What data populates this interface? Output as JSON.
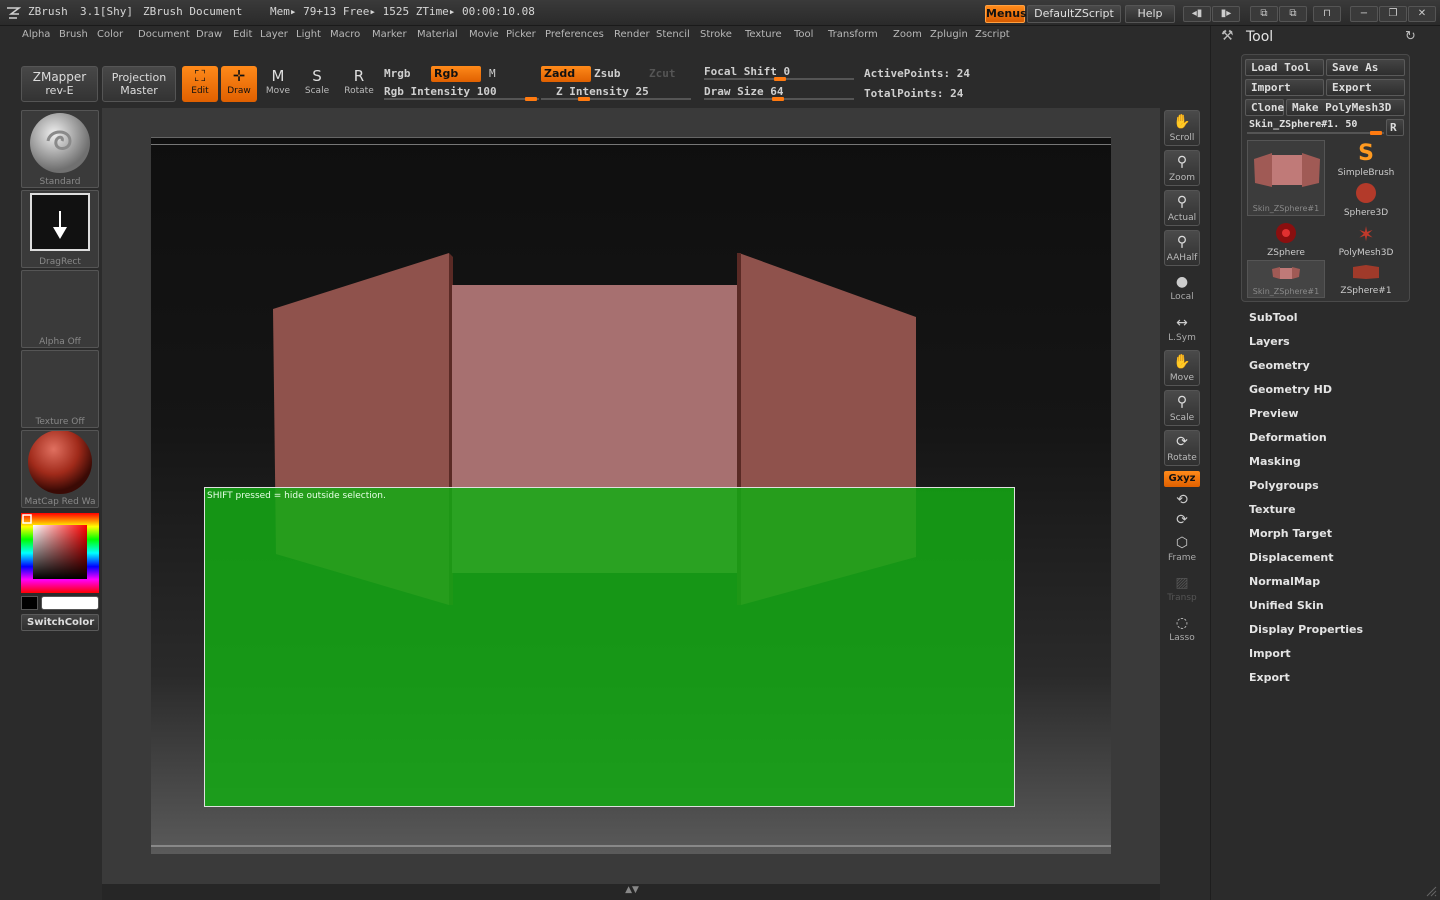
{
  "titlebar": {
    "app": "ZBrush",
    "version": "3.1[Shy]",
    "doc": "ZBrush Document",
    "mem": "Mem▸ 79+13 Free▸ 1525 ZTime▸ 00:00:10.08",
    "menus_btn": "Menus",
    "script_btn": "DefaultZScript",
    "help_btn": "Help"
  },
  "menubar": [
    "Alpha",
    "Brush",
    "Color",
    "Document",
    "Draw",
    "Edit",
    "Layer",
    "Light",
    "Macro",
    "Marker",
    "Material",
    "Movie",
    "Picker",
    "Preferences",
    "Render",
    "Stencil",
    "Stroke",
    "Texture",
    "Tool",
    "Transform",
    "Zoom",
    "Zplugin",
    "Zscript"
  ],
  "shelf": {
    "zmapper_line1": "ZMapper",
    "zmapper_line2": "rev-E",
    "projection_line1": "Projection",
    "projection_line2": "Master",
    "edit": "Edit",
    "draw": "Draw",
    "move": "Move",
    "scale": "Scale",
    "rotate": "Rotate",
    "mrgb": "Mrgb",
    "rgb": "Rgb",
    "m": "M",
    "rgb_intensity": "Rgb Intensity 100",
    "zadd": "Zadd",
    "zsub": "Zsub",
    "zcut": "Zcut",
    "z_intensity": "Z Intensity 25",
    "focal_shift": "Focal Shift 0",
    "draw_size": "Draw Size 64",
    "active_points": "ActivePoints: 24",
    "total_points": "TotalPoints: 24"
  },
  "leftpanel": {
    "standard": "Standard",
    "dragrect": "DragRect",
    "alpha": "Alpha Off",
    "texture": "Texture Off",
    "matcap": "MatCap Red Wa",
    "switchcolor": "SwitchColor"
  },
  "viewport": {
    "hint": "SHIFT pressed = hide outside selection."
  },
  "rightstrip": [
    "Scroll",
    "Zoom",
    "Actual",
    "AAHalf",
    "Local",
    "L.Sym",
    "Move",
    "Scale",
    "Rotate",
    "Frame",
    "Transp",
    "Lasso"
  ],
  "rightstrip_xyz": "Gxyz",
  "toolpanel": {
    "title": "Tool",
    "load_tool": "Load Tool",
    "save_as": "Save As",
    "import": "Import",
    "export": "Export",
    "clone": "Clone",
    "make_polymesh": "Make PolyMesh3D",
    "current_tool": "Skin_ZSphere#1. 50",
    "r_btn": "R",
    "tools": [
      "Skin_ZSphere#1",
      "SimpleBrush",
      "Sphere3D",
      "ZSphere",
      "PolyMesh3D",
      "Skin_ZSphere#1",
      "ZSphere#1"
    ],
    "sections": [
      "SubTool",
      "Layers",
      "Geometry",
      "Geometry HD",
      "Preview",
      "Deformation",
      "Masking",
      "Polygroups",
      "Texture",
      "Morph Target",
      "Displacement",
      "NormalMap",
      "Unified Skin",
      "Display Properties",
      "Import",
      "Export"
    ]
  },
  "colors": {
    "accent": "#ff7a10",
    "selection": "#1ea01e",
    "mesh": "#a05a55"
  }
}
